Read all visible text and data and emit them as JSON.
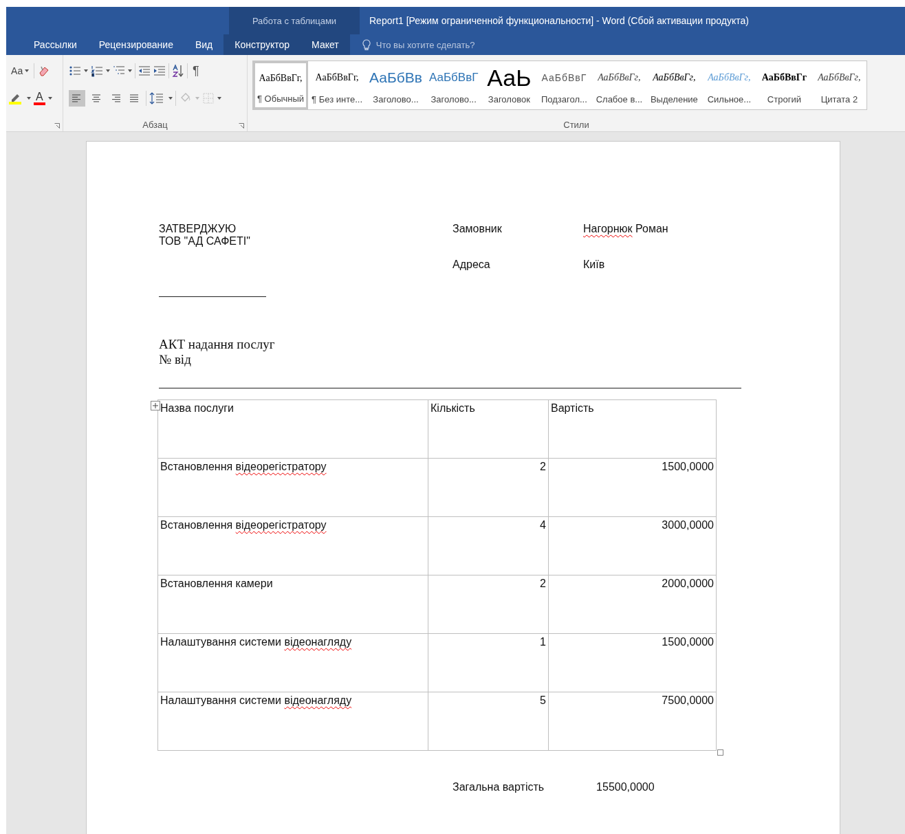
{
  "window": {
    "title": "Report1 [Режим ограниченной функциональности] - Word (Сбой активации продукта)",
    "context_group": "Работа с таблицами"
  },
  "tabs": [
    {
      "label": "Рассылки",
      "selected": false,
      "contextual": false
    },
    {
      "label": "Рецензирование",
      "selected": false,
      "contextual": false
    },
    {
      "label": "Вид",
      "selected": false,
      "contextual": false
    },
    {
      "label": "Конструктор",
      "selected": false,
      "contextual": true
    },
    {
      "label": "Макет",
      "selected": false,
      "contextual": true
    }
  ],
  "tell_me": {
    "placeholder": "Что вы хотите сделать?"
  },
  "font_group": {
    "font_size_label": "Аа",
    "font_color_label": "A"
  },
  "paragraph_group": {
    "label": "Абзац",
    "show_marks_label": "¶",
    "alignment": [
      {
        "kind": "left",
        "selected": true
      },
      {
        "kind": "center",
        "selected": false
      },
      {
        "kind": "right",
        "selected": false
      },
      {
        "kind": "justify",
        "selected": false
      }
    ]
  },
  "styles_group": {
    "label": "Стили",
    "styles": [
      {
        "kind": "normal",
        "sample": "АаБбВвГг,",
        "label": "¶ Обычный",
        "selected": true
      },
      {
        "kind": "no-spacing",
        "sample": "АаБбВвГг,",
        "label": "¶ Без инте...",
        "selected": false
      },
      {
        "kind": "heading1",
        "sample": "АаБбВв",
        "label": "Заголово...",
        "selected": false
      },
      {
        "kind": "heading2",
        "sample": "АаБбВвГ",
        "label": "Заголово...",
        "selected": false
      },
      {
        "kind": "title",
        "sample": "АаЬ",
        "label": "Заголовок",
        "selected": false
      },
      {
        "kind": "subtitle",
        "sample": "АаБбВвГ",
        "label": "Подзагол...",
        "selected": false
      },
      {
        "kind": "subtle-emphasis",
        "sample": "АаБбВвГг,",
        "label": "Слабое в...",
        "selected": false
      },
      {
        "kind": "emphasis",
        "sample": "АаБбВвГг,",
        "label": "Выделение",
        "selected": false
      },
      {
        "kind": "intense-emphasis",
        "sample": "АаБбВвГг,",
        "label": "Сильное...",
        "selected": false
      },
      {
        "kind": "strong",
        "sample": "АаБбВвГг",
        "label": "Строгий",
        "selected": false
      },
      {
        "kind": "quote",
        "sample": "АаБбВвГг,",
        "label": "Цитата 2",
        "selected": false
      }
    ]
  },
  "document": {
    "approval": [
      "ЗАТВЕРДЖУЮ",
      "ТОВ \"АД САФЕТІ\""
    ],
    "fields": [
      {
        "label": "Замовник",
        "value": [
          {
            "text": "Нагорнюк",
            "misspelled": true
          },
          {
            "text": " Роман",
            "misspelled": false
          }
        ]
      },
      {
        "label": "Адреса",
        "value": [
          {
            "text": "Київ",
            "misspelled": false
          }
        ]
      }
    ],
    "act_title": "АКТ надання послуг",
    "act_number": "№  від",
    "table": {
      "columns": [
        "Назва послуги",
        "Кількість",
        "Вартість"
      ],
      "rows": [
        {
          "name": [
            {
              "text": "Встановлення ",
              "misspelled": false
            },
            {
              "text": "відеорегістратору",
              "misspelled": true
            }
          ],
          "quantity": "2",
          "cost": "1500,0000"
        },
        {
          "name": [
            {
              "text": "Встановлення ",
              "misspelled": false
            },
            {
              "text": "відеорегістратору",
              "misspelled": true
            }
          ],
          "quantity": "4",
          "cost": "3000,0000"
        },
        {
          "name": [
            {
              "text": "Встановлення камери",
              "misspelled": false
            }
          ],
          "quantity": "2",
          "cost": "2000,0000"
        },
        {
          "name": [
            {
              "text": "Налаштування системи ",
              "misspelled": false
            },
            {
              "text": "відеонагляду",
              "misspelled": true
            }
          ],
          "quantity": "1",
          "cost": "1500,0000"
        },
        {
          "name": [
            {
              "text": "Налаштування системи ",
              "misspelled": false
            },
            {
              "text": "відеонагляду",
              "misspelled": true
            }
          ],
          "quantity": "5",
          "cost": "7500,0000"
        }
      ]
    },
    "total_label": "Загальна вартість",
    "total_value": "15500,0000"
  }
}
